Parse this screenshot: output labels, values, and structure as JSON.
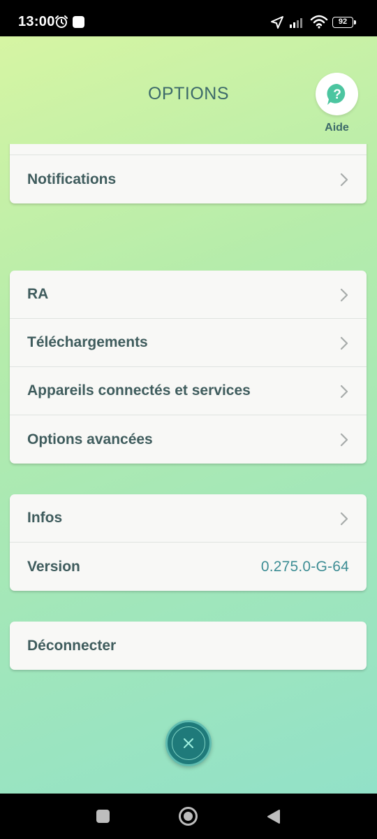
{
  "status_bar": {
    "time": "13:00",
    "battery": "92",
    "icons": [
      "alarm-icon",
      "app-notification-icon",
      "location-arrow-icon",
      "cell-signal-icon",
      "wifi-icon",
      "battery-icon"
    ]
  },
  "header": {
    "title": "OPTIONS",
    "help_label": "Aide",
    "help_icon": "question-bubble-icon"
  },
  "groups": [
    {
      "rows": [
        {
          "label": ""
        },
        {
          "label": "Notifications"
        }
      ]
    },
    {
      "rows": [
        {
          "label": "RA"
        },
        {
          "label": "Téléchargements"
        },
        {
          "label": "Appareils connectés et services"
        },
        {
          "label": "Options avancées"
        }
      ]
    },
    {
      "rows": [
        {
          "label": "Infos"
        },
        {
          "label": "Version",
          "value": "0.275.0-G-64"
        }
      ]
    },
    {
      "rows": [
        {
          "label": "Déconnecter"
        }
      ]
    }
  ],
  "close_icon": "close-icon",
  "nav_bar": [
    "recents-icon",
    "home-icon",
    "back-icon"
  ],
  "colors": {
    "title": "#3d6a6a",
    "row_label": "#3f5c5d",
    "version_value": "#3d8d94",
    "help_icon": "#4cc5a0",
    "close_button": "#1f7a7a"
  }
}
